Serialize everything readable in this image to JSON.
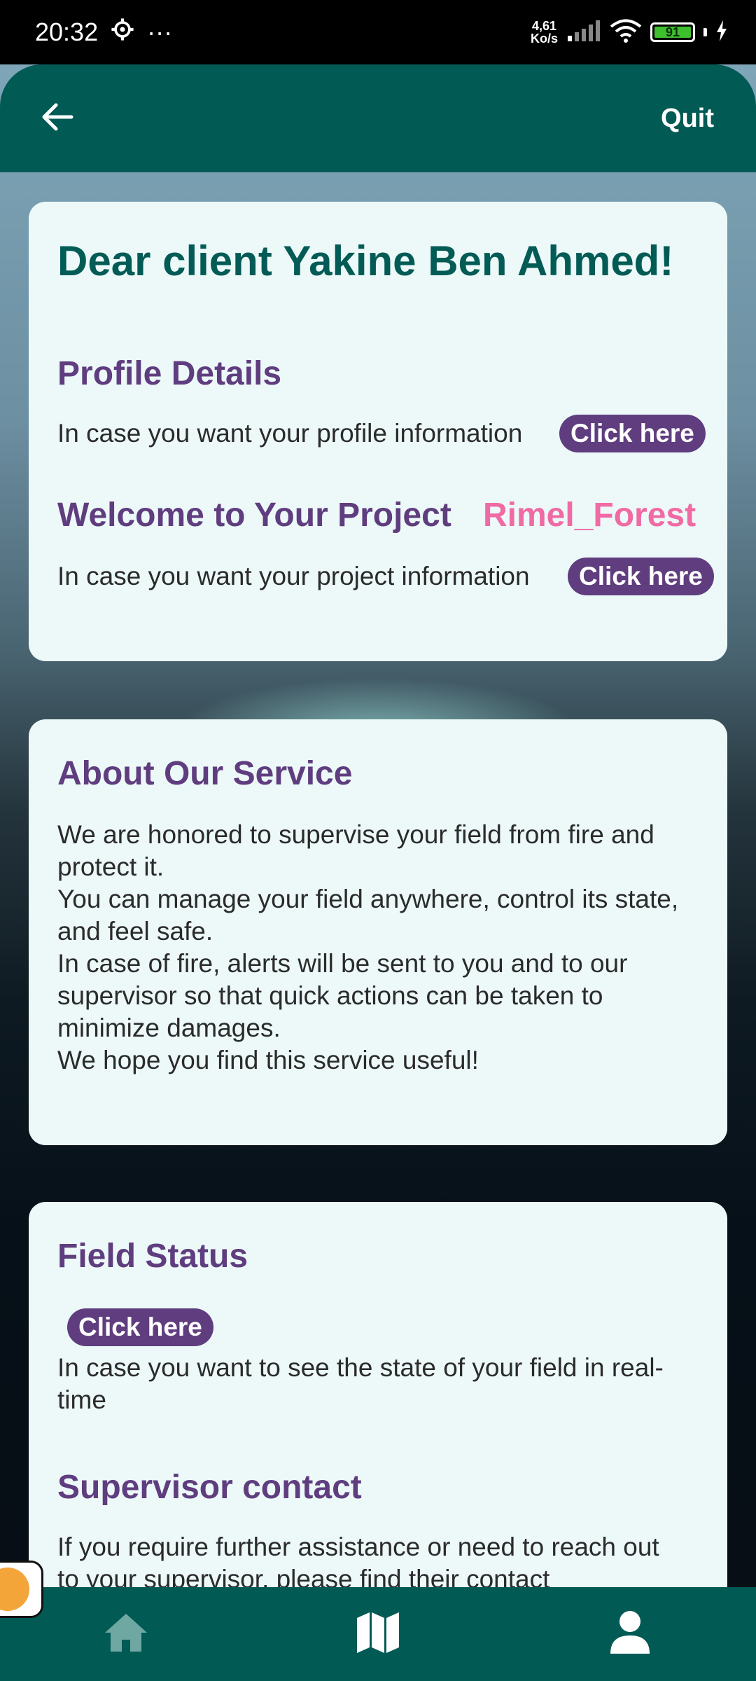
{
  "status_bar": {
    "time": "20:32",
    "more": "···",
    "net_speed_value": "4,61",
    "net_speed_unit": "Ko/s",
    "battery_level": "91"
  },
  "app_bar": {
    "quit_label": "Quit"
  },
  "welcome_card": {
    "greeting": "Dear client Yakine Ben Ahmed!",
    "profile_title": "Profile Details",
    "profile_text": "In case you want your profile information",
    "profile_link": "Click here",
    "project_title": "Welcome to Your Project",
    "project_name": "Rimel_Forest",
    "project_text": "In case you want your project information",
    "project_link": "Click here"
  },
  "about_card": {
    "title": "About Our Service",
    "line1": "We are honored to supervise your field from fire and protect it.",
    "line2": "You can manage your field anywhere, control its state, and feel safe.",
    "line3": "In case of fire, alerts will be sent to you and to our supervisor so that quick actions can be taken to minimize damages.",
    "line4": "We hope you find this service useful!"
  },
  "field_card": {
    "title": "Field Status",
    "link": "Click here",
    "text": "In case you want to see the state of your field in real-time",
    "supervisor_title": "Supervisor contact",
    "supervisor_text": "If you require further assistance or need to reach out to your supervisor, please find their contact"
  },
  "colors": {
    "primary": "#025a55",
    "accent_purple": "#5f3d7f",
    "project_pink": "#f06aa4",
    "card_bg": "#ecf9f8"
  },
  "icons": {
    "back": "arrow-left-icon",
    "home": "home-icon",
    "map": "map-icon",
    "profile": "user-icon"
  }
}
